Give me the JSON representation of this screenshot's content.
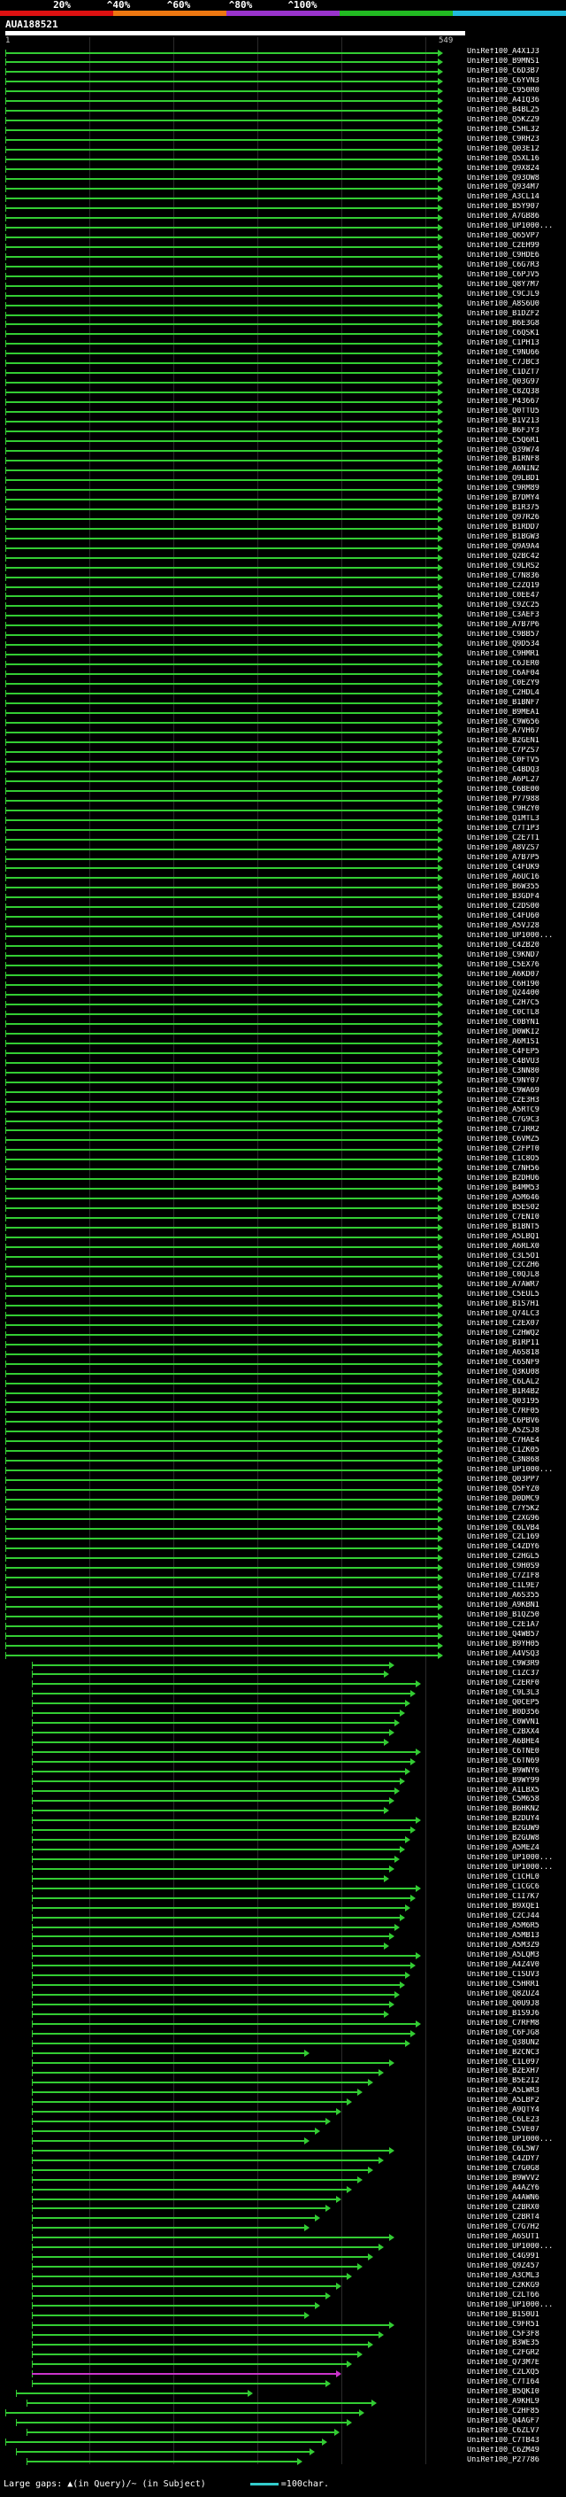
{
  "scale": {
    "ticks": [
      "20%",
      "^40%",
      "^60%",
      "^80%",
      "^100%"
    ],
    "colors": [
      "#dd1111",
      "#ee7711",
      "#9933cc",
      "#22bb22",
      "#22bbdd"
    ]
  },
  "query": {
    "name": "AUA188521",
    "start": "1",
    "end": "549"
  },
  "legend": {
    "gaps": "Large gaps: ▲(in Query)/~ (in Subject)",
    "scale": "=100char."
  },
  "hits": [
    "UniRef100_A4X1J3",
    "UniRef100_B9MNS1",
    "UniRef100_C6D3B7",
    "UniRef100_C6YVN3",
    "UniRef100_C950R0",
    "UniRef100_A4IQ36",
    "UniRef100_B4BL25",
    "UniRef100_Q5KZ29",
    "UniRef100_C5HL32",
    "UniRef100_C9RH23",
    "UniRef100_Q03E12",
    "UniRef100_Q5XL16",
    "UniRef100_Q9X824",
    "UniRef100_Q93OW8",
    "UniRef100_Q934M7",
    "UniRef100_A3CL14",
    "UniRef100_B5Y907",
    "UniRef100_A7GB86",
    "UniRef100_UP1000...",
    "UniRef100_Q65VP7",
    "UniRef100_C2EH99",
    "UniRef100_C9HDE6",
    "UniRef100_C6G7R3",
    "UniRef100_C6PJV5",
    "UniRef100_Q8Y7M7",
    "UniRef100_C9CJL9",
    "UniRef100_A8S6U0",
    "UniRef100_B1DZF2",
    "UniRef100_B6E3G8",
    "UniRef100_C6QSK1",
    "UniRef100_C1PH13",
    "UniRef100_C9NU66",
    "UniRef100_C7JBC3",
    "UniRef100_C1DZT7",
    "UniRef100_Q03G97",
    "UniRef100_C8ZQ38",
    "UniRef100_P43667",
    "UniRef100_Q0TTU5",
    "UniRef100_B1V213",
    "UniRef100_B6FJY3",
    "UniRef100_C5Q6R1",
    "UniRef100_Q39W74",
    "UniRef100_B1RNF8",
    "UniRef100_A6NIN2",
    "UniRef100_Q9LBD1",
    "UniRef100_C9RM89",
    "UniRef100_B7DMY4",
    "UniRef100_B1R375",
    "UniRef100_Q97R26",
    "UniRef100_B1RDD7",
    "UniRef100_B1BGW3",
    "UniRef100_Q9A9A4",
    "UniRef100_Q2BC42",
    "UniRef100_C9LRS2",
    "UniRef100_C7N836",
    "UniRef100_C2ZQ19",
    "UniRef100_C0EE47",
    "UniRef100_C9ZC25",
    "UniRef100_C3AEF3",
    "UniRef100_A7B7P6",
    "UniRef100_C9BB57",
    "UniRef100_Q9D534",
    "UniRef100_C9HMR1",
    "UniRef100_C6JER0",
    "UniRef100_C6AF04",
    "UniRef100_C0EZY9",
    "UniRef100_C2HDL4",
    "UniRef100_B1BNF7",
    "UniRef100_B9MEA1",
    "UniRef100_C9W656",
    "UniRef100_A7VH67",
    "UniRef100_B2GEN1",
    "UniRef100_C7PZS7",
    "UniRef100_C0FTV5",
    "UniRef100_C4BDQ3",
    "UniRef100_A6PL27",
    "UniRef100_C6BE00",
    "UniRef100_P77988",
    "UniRef100_C9HZY0",
    "UniRef100_Q1MTL3",
    "UniRef100_C7T1P3",
    "UniRef100_C2E7T1",
    "UniRef100_A8VZS7",
    "UniRef100_A7B7P5",
    "UniRef100_C4FUK9",
    "UniRef100_A6UC16",
    "UniRef100_B6W355",
    "UniRef100_B3GDF4",
    "UniRef100_C2DS00",
    "UniRef100_C4FU60",
    "UniRef100_A5VJ28",
    "UniRef100_UP1000...",
    "UniRef100_C4ZB20",
    "UniRef100_C9KND7",
    "UniRef100_C5EX76",
    "UniRef100_A6KD07",
    "UniRef100_C6H190",
    "UniRef100_Q24400",
    "UniRef100_C2H7C5",
    "UniRef100_C0CTL8",
    "UniRef100_C0BYN1",
    "UniRef100_D0WKI2",
    "UniRef100_A6M1S1",
    "UniRef100_C4FEP5",
    "UniRef100_C4BVU3",
    "UniRef100_C3NN80",
    "UniRef100_C9NY07",
    "UniRef100_C9WA69",
    "UniRef100_C2E3H3",
    "UniRef100_A5RTC9",
    "UniRef100_C7G9C3",
    "UniRef100_C7JRR2",
    "UniRef100_C6VMZ5",
    "UniRef100_C2FPT0",
    "UniRef100_C1C8O5",
    "UniRef100_C7NH56",
    "UniRef100_B2DHU6",
    "UniRef100_B4MM53",
    "UniRef100_A5M646",
    "UniRef100_B5ES02",
    "UniRef100_C7ENI0",
    "UniRef100_B1BNT5",
    "UniRef100_A5LBQ1",
    "UniRef100_A6RLX0",
    "UniRef100_C3L5O1",
    "UniRef100_C2CZH6",
    "UniRef100_C0QJL8",
    "UniRef100_A7AWR7",
    "UniRef100_C5EUL5",
    "UniRef100_B1S7H1",
    "UniRef100_Q74LC3",
    "UniRef100_C2EX07",
    "UniRef100_C2HWQ2",
    "UniRef100_B1RP11",
    "UniRef100_A6S818",
    "UniRef100_C6SNF9",
    "UniRef100_Q3KU08",
    "UniRef100_C6LAL2",
    "UniRef100_B1R4B2",
    "UniRef100_Q03195",
    "UniRef100_C7RF05",
    "UniRef100_C6PBV6",
    "UniRef100_A5ZSJ8",
    "UniRef100_C7HAE4",
    "UniRef100_C1ZK05",
    "UniRef100_C3N868",
    "UniRef100_UP1000...",
    "UniRef100_Q03PP7",
    "UniRef100_Q5FYZ0",
    "UniRef100_D0DMC9",
    "UniRef100_C7Y5K2",
    "UniRef100_C2XG96",
    "UniRef100_C6LVB4",
    "UniRef100_C2L169",
    "UniRef100_C4ZDY6",
    "UniRef100_C2HGL5",
    "UniRef100_C9H0S9",
    "UniRef100_C7ZIF8",
    "UniRef100_C1L9E7",
    "UniRef100_A6S355",
    "UniRef100_A9KBN1",
    "UniRef100_B1QZ50",
    "UniRef100_C2E1A7",
    "UniRef100_Q4WB57",
    "UniRef100_B9YH05",
    "UniRef100_A4VSQ3",
    "UniRef100_C9W3R9",
    "UniRef100_C1ZC37",
    "UniRef100_C2ERF0",
    "UniRef100_C9L3L3",
    "UniRef100_Q0CEP5",
    "UniRef100_B0D356",
    "UniRef100_C0WVN1",
    "UniRef100_C2BXX4",
    "UniRef100_A6BHE4",
    "UniRef100_C6TNE0",
    "UniRef100_C6TN69",
    "UniRef100_B9WNY6",
    "UniRef100_B9WY99",
    "UniRef100_A1LBX5",
    "UniRef100_C5M658",
    "UniRef100_B6HKN2",
    "UniRef100_B2DUY4",
    "UniRef100_B2GUW9",
    "UniRef100_B2GUW8",
    "UniRef100_A5MEZ4",
    "UniRef100_UP1000...",
    "UniRef100_UP1000...",
    "UniRef100_C1CHL0",
    "UniRef100_C1CGC6",
    "UniRef100_C1I7K7",
    "UniRef100_B9XQE1",
    "UniRef100_C2CJ44",
    "UniRef100_A5M6R5",
    "UniRef100_A5MB13",
    "UniRef100_A5M3Z9",
    "UniRef100_A5LQM3",
    "UniRef100_A4Z4V0",
    "UniRef100_C1SUV3",
    "UniRef100_C5HRR1",
    "UniRef100_Q8ZUZ4",
    "UniRef100_Q0U9J8",
    "UniRef100_B1S9J6",
    "UniRef100_C7RFM8",
    "UniRef100_C6FJG8",
    "UniRef100_Q38UN2",
    "UniRef100_B2CNC3",
    "UniRef100_C1L097",
    "UniRef100_B2EXH7",
    "UniRef100_B5E2I2",
    "UniRef100_A5LWR3",
    "UniRef100_A5LBF2",
    "UniRef100_A9QTY4",
    "UniRef100_C6LE23",
    "UniRef100_C5VE07",
    "UniRef100_UP1000...",
    "UniRef100_C6L5W7",
    "UniRef100_C4ZDY7",
    "UniRef100_C7G0G8",
    "UniRef100_B9WVV2",
    "UniRef100_A4AZY6",
    "UniRef100_A4AWN6",
    "UniRef100_C2BRX0",
    "UniRef100_C2BRT4",
    "UniRef100_C7G7H2",
    "UniRef100_A6SUT1",
    "UniRef100_UP1000...",
    "UniRef100_C4G991",
    "UniRef100_Q9Z457",
    "UniRef100_A3CML3",
    "UniRef100_C2KKG9",
    "UniRef100_C2LT66",
    "UniRef100_UP1000...",
    "UniRef100_B1S0U1",
    "UniRef100_C9FR51",
    "UniRef100_C5F3F8",
    "UniRef100_B3WE35",
    "UniRef100_C2FGR2",
    "UniRef100_Q73M7E",
    "UniRef100_C2LXQ5",
    "UniRef100_C7TI64",
    "UniRef100_B5QKI0",
    "UniRef100_A9KHL9",
    "UniRef100_C2HF85",
    "UniRef100_Q4AGF7",
    "UniRef100_C6ZLV7",
    "UniRef100_C7TB43",
    "UniRef100_C6ZM49",
    "UniRef100_P27786"
  ]
}
